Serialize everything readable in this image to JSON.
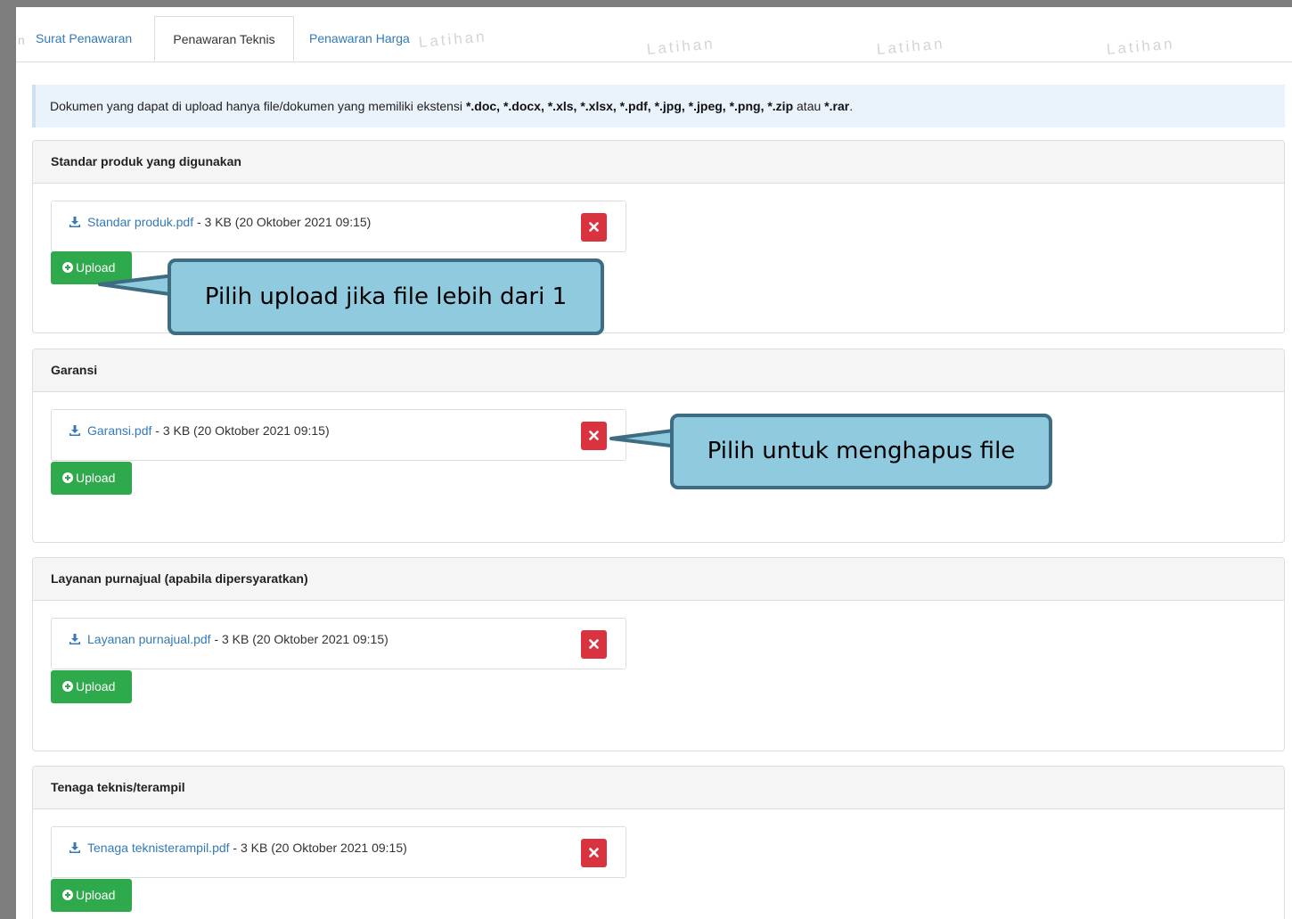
{
  "tabs": {
    "lead": "n",
    "items": [
      {
        "label": "Surat Penawaran"
      },
      {
        "label": "Penawaran Teknis"
      },
      {
        "label": "Penawaran Harga"
      }
    ],
    "watermark": "Latihan"
  },
  "alert": {
    "prefix": "Dokumen yang dapat di upload hanya file/dokumen yang memiliki ekstensi ",
    "extensions": "*.doc, *.docx, *.xls, *.xlsx, *.pdf, *.jpg, *.jpeg, *.png, *.zip",
    "conjunction": " atau ",
    "last_extension": "*.rar",
    "suffix": "."
  },
  "panels": [
    {
      "title": "Standar produk yang digunakan",
      "file_name": "Standar produk.pdf",
      "file_meta": " - 3 KB (20 Oktober 2021 09:15)",
      "upload_label": "Upload"
    },
    {
      "title": "Garansi",
      "file_name": "Garansi.pdf",
      "file_meta": " - 3 KB (20 Oktober 2021 09:15)",
      "upload_label": "Upload"
    },
    {
      "title": "Layanan purnajual (apabila dipersyaratkan)",
      "file_name": "Layanan purnajual.pdf",
      "file_meta": " - 3 KB (20 Oktober 2021 09:15)",
      "upload_label": "Upload"
    },
    {
      "title": "Tenaga teknis/terampil",
      "file_name": "Tenaga teknisterampil.pdf",
      "file_meta": " - 3 KB (20 Oktober 2021 09:15)",
      "upload_label": "Upload"
    }
  ],
  "callouts": {
    "upload": "Pilih upload jika file lebih dari 1",
    "delete": "Pilih untuk menghapus file"
  },
  "colors": {
    "link": "#337ab7",
    "upload_button": "#2ea94b",
    "delete_button": "#d9333f",
    "callout_fill": "#8fcadf",
    "callout_border": "#3e6d82"
  },
  "icons": {
    "file": "download-icon",
    "delete": "close-icon",
    "upload": "plus-circle-icon"
  }
}
